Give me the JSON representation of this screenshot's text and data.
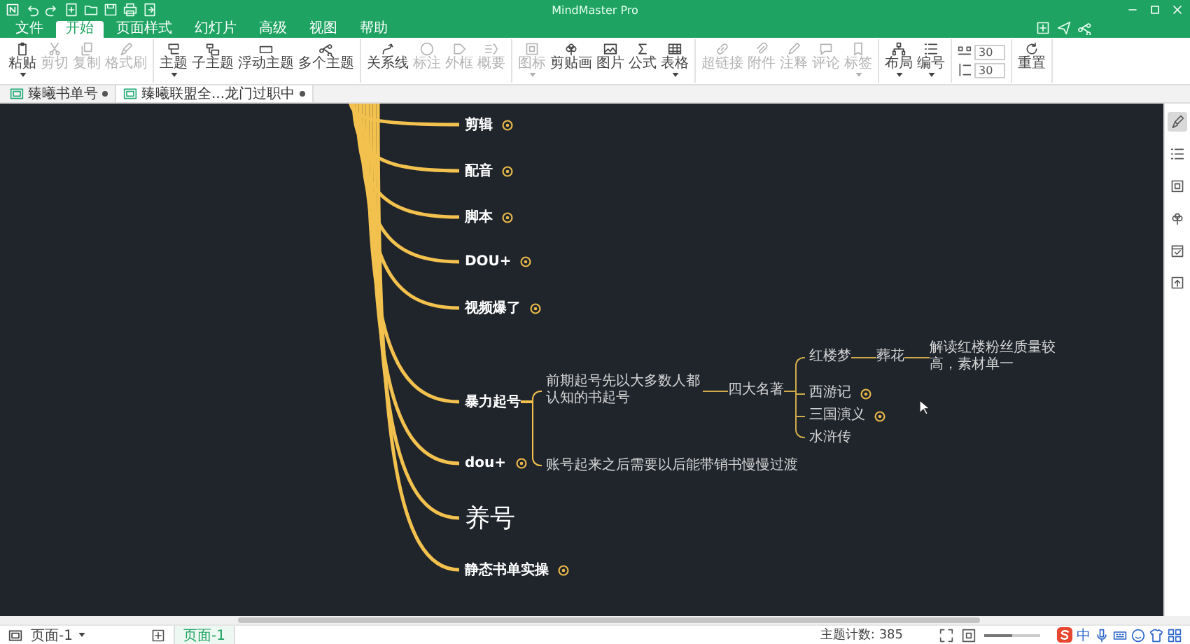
{
  "window": {
    "title": "MindMaster Pro"
  },
  "menu_tabs": [
    {
      "label": "文件",
      "selected": false
    },
    {
      "label": "开始",
      "selected": true
    },
    {
      "label": "页面样式",
      "selected": false
    },
    {
      "label": "幻灯片",
      "selected": false
    },
    {
      "label": "高级",
      "selected": false
    },
    {
      "label": "视图",
      "selected": false
    },
    {
      "label": "帮助",
      "selected": false
    }
  ],
  "toolbar": {
    "groups": [
      [
        {
          "label": "粘贴",
          "disabled": false,
          "dropdown": true
        },
        {
          "label": "剪切",
          "disabled": true,
          "dropdown": false
        },
        {
          "label": "复制",
          "disabled": true,
          "dropdown": false
        },
        {
          "label": "格式刷",
          "disabled": true,
          "dropdown": false
        }
      ],
      [
        {
          "label": "主题",
          "disabled": false,
          "dropdown": true
        },
        {
          "label": "子主题",
          "disabled": false,
          "dropdown": false
        },
        {
          "label": "浮动主题",
          "disabled": false,
          "dropdown": false
        },
        {
          "label": "多个主题",
          "disabled": false,
          "dropdown": false
        }
      ],
      [
        {
          "label": "关系线",
          "disabled": false,
          "dropdown": false
        },
        {
          "label": "标注",
          "disabled": true,
          "dropdown": false
        },
        {
          "label": "外框",
          "disabled": true,
          "dropdown": false
        },
        {
          "label": "概要",
          "disabled": true,
          "dropdown": false
        }
      ],
      [
        {
          "label": "图标",
          "disabled": true,
          "dropdown": true
        },
        {
          "label": "剪贴画",
          "disabled": false,
          "dropdown": false
        },
        {
          "label": "图片",
          "disabled": false,
          "dropdown": false
        },
        {
          "label": "公式",
          "disabled": false,
          "dropdown": false
        },
        {
          "label": "表格",
          "disabled": false,
          "dropdown": true
        }
      ],
      [
        {
          "label": "超链接",
          "disabled": true,
          "dropdown": false
        },
        {
          "label": "附件",
          "disabled": true,
          "dropdown": false
        },
        {
          "label": "注释",
          "disabled": true,
          "dropdown": false
        },
        {
          "label": "评论",
          "disabled": true,
          "dropdown": false
        },
        {
          "label": "标签",
          "disabled": true,
          "dropdown": true
        }
      ],
      [
        {
          "label": "布局",
          "disabled": false,
          "dropdown": true
        },
        {
          "label": "编号",
          "disabled": false,
          "dropdown": true
        }
      ]
    ],
    "spinners": [
      "30",
      "30"
    ],
    "reset": {
      "label": "重置"
    }
  },
  "document_tabs": [
    {
      "label": "臻曦书单号",
      "selected": false,
      "modified": true
    },
    {
      "label": "臻曦联盟全...龙门过职中",
      "selected": true,
      "modified": true
    }
  ],
  "mind_map": {
    "topics": [
      {
        "text": "剪辑",
        "collapsed": true,
        "large": false
      },
      {
        "text": "配音",
        "collapsed": true,
        "large": false
      },
      {
        "text": "脚本",
        "collapsed": true,
        "large": false
      },
      {
        "text": "DOU+",
        "collapsed": true,
        "large": false
      },
      {
        "text": "视频爆了",
        "collapsed": true,
        "large": false
      },
      {
        "text": "暴力起号",
        "collapsed": false,
        "large": false,
        "children": [
          {
            "text": "前期起号先以大多数人都认知的书起号",
            "collapsed": false,
            "children": [
              {
                "text": "四大名著",
                "collapsed": false,
                "children": [
                  {
                    "text": "红楼梦",
                    "collapsed": false,
                    "children": [
                      {
                        "text": "葬花",
                        "collapsed": false,
                        "children": [
                          {
                            "text": "解读红楼粉丝质量较高，素材单一",
                            "collapsed": false
                          }
                        ]
                      }
                    ]
                  },
                  {
                    "text": "西游记",
                    "collapsed": true
                  },
                  {
                    "text": "三国演义",
                    "collapsed": true
                  },
                  {
                    "text": "水浒传",
                    "collapsed": false
                  }
                ]
              }
            ]
          },
          {
            "text": "账号起来之后需要以后能带销书慢慢过渡",
            "collapsed": false
          }
        ]
      },
      {
        "text": "dou+",
        "collapsed": true,
        "large": false
      },
      {
        "text": "养号",
        "collapsed": false,
        "large": true
      },
      {
        "text": "静态书单实操",
        "collapsed": true,
        "large": false
      }
    ]
  },
  "sidebar": {
    "panels": [
      {
        "selected": true
      },
      {
        "selected": false
      },
      {
        "selected": false
      },
      {
        "selected": false
      },
      {
        "selected": false
      },
      {
        "selected": false
      }
    ]
  },
  "status_bar": {
    "page_select": "页面-1",
    "pages": [
      {
        "label": "页面-1",
        "selected": true
      }
    ],
    "topic_count": "主题计数: 385",
    "zoom": {
      "level": 0.5
    },
    "ime_mode": "中"
  }
}
